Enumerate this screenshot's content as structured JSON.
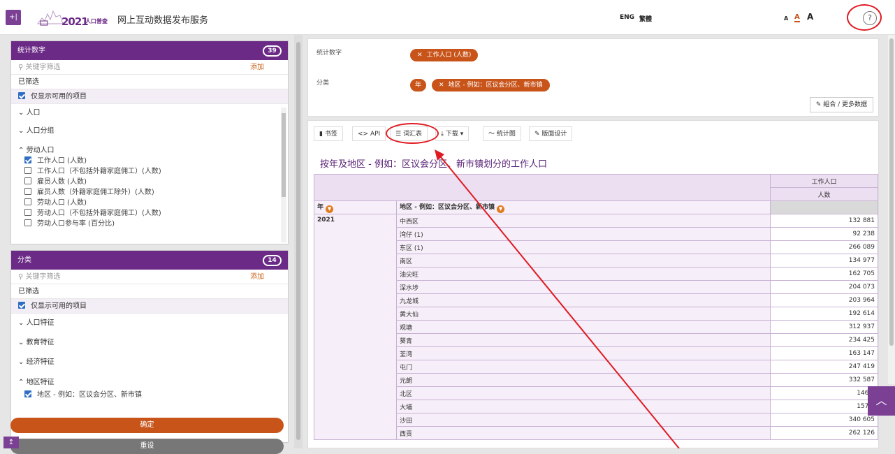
{
  "header": {
    "collapse_icon": "+|",
    "logo": {
      "year": "2021",
      "sub": "人口普查"
    },
    "title": "网上互动数据发布服务",
    "lang_eng": "ENG",
    "lang_trad": "繁體",
    "font_small": "A",
    "font_medium": "A",
    "font_large": "A",
    "help": "?"
  },
  "stats_panel": {
    "title": "统计数字",
    "count": "39",
    "search_placeholder": "关键字筛选",
    "add": "添加",
    "filtered": "已筛选",
    "show_available": "仅显示可用的项目",
    "groups": {
      "population": "人口",
      "population_group": "人口分组",
      "labour": "劳动人口"
    },
    "items": [
      {
        "label": "工作人口 (人数)",
        "checked": true
      },
      {
        "label": "工作人口（不包括外籍家庭佣工）(人数)",
        "checked": false
      },
      {
        "label": "雇员人数 (人数)",
        "checked": false
      },
      {
        "label": "雇员人数（外籍家庭佣工除外）(人数)",
        "checked": false
      },
      {
        "label": "劳动人口 (人数)",
        "checked": false
      },
      {
        "label": "劳动人口（不包括外籍家庭佣工）(人数)",
        "checked": false
      },
      {
        "label": "劳动人口参与率 (百分比)",
        "checked": false
      }
    ]
  },
  "category_panel": {
    "title": "分类",
    "count": "14",
    "search_placeholder": "关键字筛选",
    "add": "添加",
    "filtered": "已筛选",
    "show_available": "仅显示可用的项目",
    "groups": {
      "pop_char": "人口特征",
      "edu_char": "教育特征",
      "econ_char": "经济特征",
      "geo_char": "地区特征"
    },
    "geo_item": "地区 - 例如：区议会分区、新市镇"
  },
  "buttons": {
    "confirm": "确定",
    "reset": "重设"
  },
  "selection": {
    "stats_label": "统计数字",
    "stats_chip": "工作人口 (人数)",
    "cat_label": "分类",
    "year_chip": "年",
    "area_chip": "地区 - 例如：区议会分区、新市镇",
    "more": "組合 / 更多数据"
  },
  "toolbar": {
    "bookmark": "书签",
    "api": "API",
    "glossary": "词汇表",
    "download": "下载",
    "chart": "统计图",
    "layout": "版面设计"
  },
  "table": {
    "title": "按年及地区 - 例如：区议会分区、新市镇划分的工作人口",
    "col_header": "工作人口",
    "col_unit": "人数",
    "year_label": "年",
    "area_label": "地区 - 例如：区议会分区、新市镇",
    "year": "2021",
    "rows": [
      {
        "d": "中西区",
        "v": "132 881"
      },
      {
        "d": "湾仔 (1)",
        "v": "92 238"
      },
      {
        "d": "东区 (1)",
        "v": "266 089"
      },
      {
        "d": "南区",
        "v": "134 977"
      },
      {
        "d": "油尖旺",
        "v": "162 705"
      },
      {
        "d": "深水埗",
        "v": "204 073"
      },
      {
        "d": "九龙城",
        "v": "203 964"
      },
      {
        "d": "黄大仙",
        "v": "192 614"
      },
      {
        "d": "观塘",
        "v": "312 937"
      },
      {
        "d": "葵青",
        "v": "234 425"
      },
      {
        "d": "荃湾",
        "v": "163 147"
      },
      {
        "d": "屯门",
        "v": "247 419"
      },
      {
        "d": "元朗",
        "v": "332 587"
      },
      {
        "d": "北区",
        "v": "146 4"
      },
      {
        "d": "大埔",
        "v": "157 8"
      },
      {
        "d": "沙田",
        "v": "340 605"
      },
      {
        "d": "西贡",
        "v": "262 126"
      }
    ]
  }
}
